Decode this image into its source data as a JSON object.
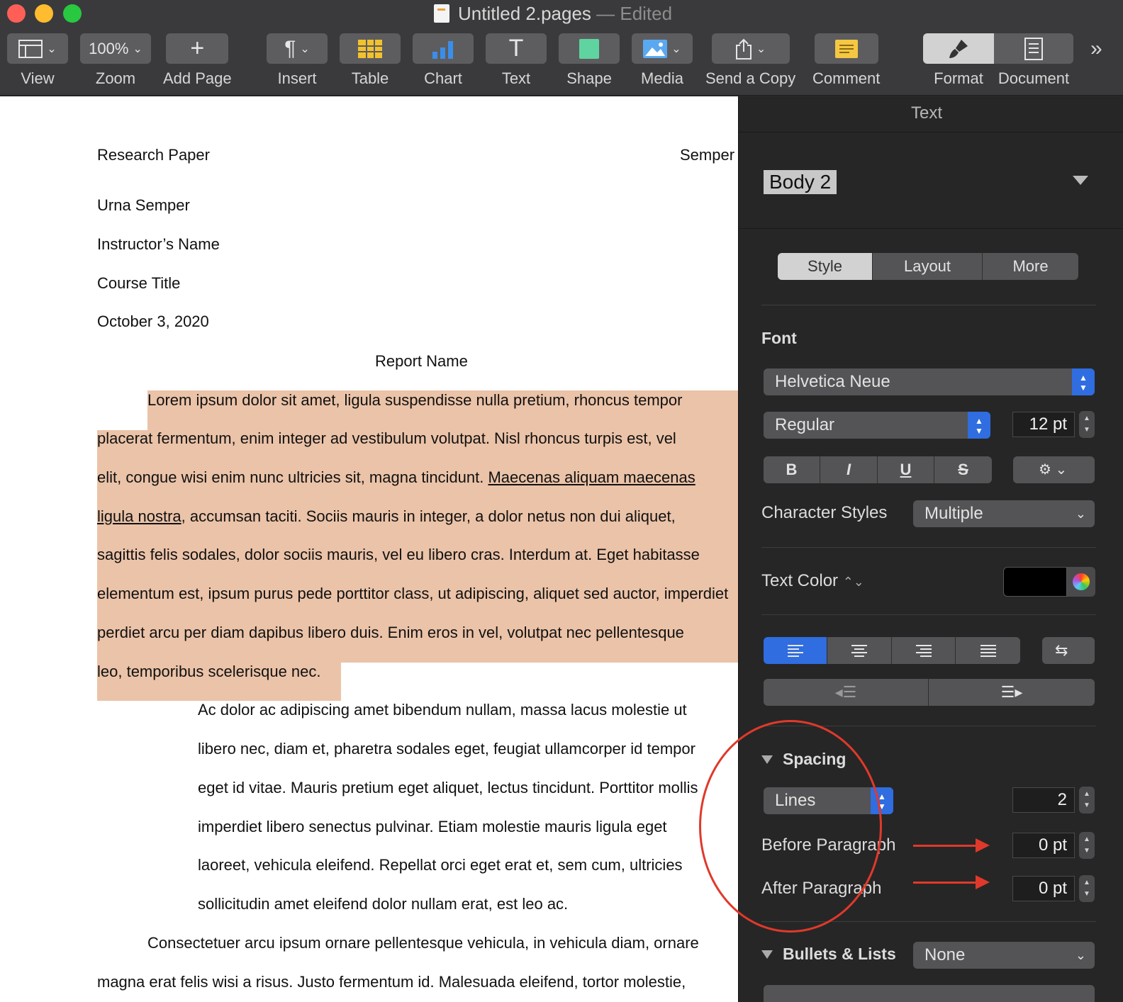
{
  "window": {
    "title": "Untitled 2.pages",
    "edited": " — Edited"
  },
  "toolbar": {
    "view": "View",
    "zoom_value": "100%",
    "zoom": "Zoom",
    "add_page": "Add Page",
    "insert": "Insert",
    "table": "Table",
    "chart": "Chart",
    "text": "Text",
    "shape": "Shape",
    "media": "Media",
    "send_copy": "Send a Copy",
    "comment": "Comment",
    "format": "Format",
    "document": "Document",
    "overflow": "»"
  },
  "doc": {
    "header_left": "Research Paper",
    "header_right": "Semper",
    "author": "Urna Semper",
    "instructor": "Instructor’s Name",
    "course": "Course Title",
    "date": "October 3, 2020",
    "report_title": "Report Name",
    "p1": [
      "Lorem ipsum dolor sit amet, ligula suspendisse nulla pretium, rhoncus tempor",
      "placerat fermentum, enim integer ad vestibulum volutpat. Nisl rhoncus turpis est, vel",
      "elit, congue wisi enim nunc ultricies sit, magna tincidunt. ",
      "Maecenas aliquam maecenas",
      "ligula nostra",
      ", accumsan taciti. Sociis mauris in integer, a dolor netus non dui aliquet,",
      "sagittis felis sodales, dolor sociis mauris, vel eu libero cras. Interdum at. Eget habitasse",
      "elementum est, ipsum purus pede porttitor class, ut adipiscing, aliquet sed auctor, imperdiet",
      "perdiet arcu per diam dapibus libero duis. Enim eros in vel, volutpat nec pellentesque",
      "leo, temporibus scelerisque nec."
    ],
    "quote": [
      "Ac dolor ac adipiscing amet bibendum nullam, massa lacus molestie ut",
      "libero nec, diam et, pharetra sodales eget, feugiat ullamcorper id tempor",
      "eget id vitae. Mauris pretium eget aliquet, lectus tincidunt. Porttitor mollis",
      "imperdiet libero senectus pulvinar. Etiam molestie mauris ligula eget",
      "laoreet, vehicula eleifend. Repellat orci eget erat et, sem cum, ultricies",
      "sollicitudin amet eleifend dolor nullam erat, est leo ac."
    ],
    "p2": [
      "Consectetuer arcu ipsum ornare pellentesque vehicula, in vehicula diam, ornare",
      "magna erat felis wisi a risus. Justo fermentum id. Malesuada eleifend, tortor molestie,"
    ]
  },
  "sidebar": {
    "header": "Text",
    "paragraph_style": "Body 2",
    "tabs": [
      "Style",
      "Layout",
      "More"
    ],
    "font_section": "Font",
    "font_family": "Helvetica Neue",
    "font_style": "Regular",
    "font_size": "12 pt",
    "bold": "B",
    "italic": "I",
    "underline": "U",
    "strike": "S",
    "char_styles_label": "Character Styles",
    "char_styles_value": "Multiple",
    "text_color_label": "Text Color",
    "text_color": "#000000",
    "spacing_label": "Spacing",
    "spacing_mode": "Lines",
    "spacing_value": "2",
    "before_label": "Before Paragraph",
    "before_value": "0 pt",
    "after_label": "After Paragraph",
    "after_value": "0 pt",
    "bullets_label": "Bullets & Lists",
    "bullets_value": "None"
  },
  "colors": {
    "highlight": "#ebc3a8",
    "accent_blue": "#2f6de0",
    "annotation_red": "#e0392b"
  }
}
